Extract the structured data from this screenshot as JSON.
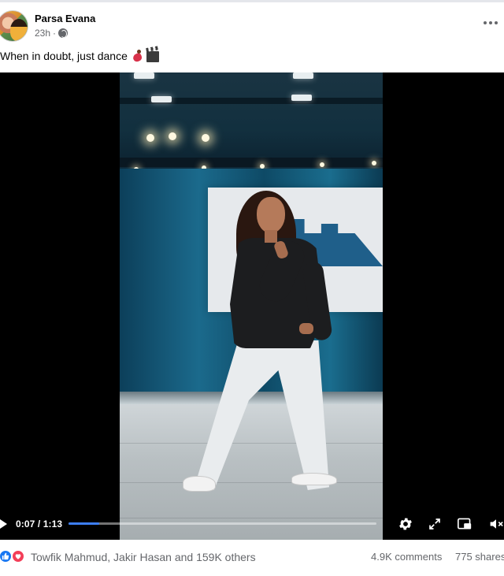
{
  "post": {
    "author": "Parsa Evana",
    "time": "23h",
    "separator": "·",
    "audience_icon": "globe-icon",
    "more_icon": "more-horizontal-icon",
    "caption": "When in doubt, just dance",
    "caption_emojis": [
      "dancer-emoji",
      "clapper-board-emoji"
    ]
  },
  "video": {
    "time_display": "0:07 / 1:13",
    "current": "0:07",
    "duration": "1:13",
    "progress": 0.1,
    "controls": [
      "play-icon",
      "settings-icon",
      "expand-icon",
      "picture-in-picture-icon",
      "volume-icon"
    ],
    "accent_color": "#3d7ef5"
  },
  "reactions": {
    "icons": [
      "like-icon",
      "love-icon"
    ],
    "summary": "Towfik Mahmud, Jakir Hasan and 159K others",
    "comments": "4.9K comments",
    "shares": "775 shares",
    "like_color": "#1877f2",
    "love_color": "#f33e58"
  }
}
